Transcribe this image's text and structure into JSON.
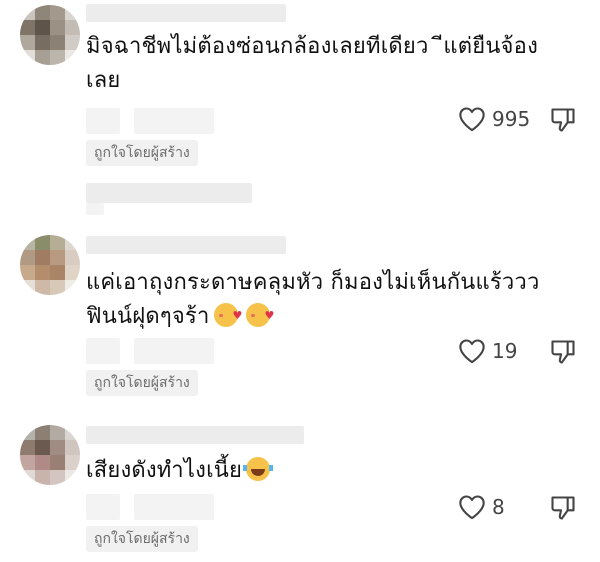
{
  "comments": [
    {
      "text_line1": "มิจฉาชีพไม่ต้องซ่อนกล้องเลยทีเดียว ​ ีแต่ยืนจ้อง",
      "text_line2": "เลย",
      "liked_by_creator_label": "ถูกใจโดยผู้สร้าง",
      "like_count": "995"
    },
    {
      "text_line1": "แค่เอาถุงกระดาษคลุมหัว ก็มองไม่เห็นกันแร้ววว",
      "text_line2": "ฟินน์ฝุดๆจร้า",
      "liked_by_creator_label": "ถูกใจโดยผู้สร้าง",
      "like_count": "19"
    },
    {
      "text_line1": "เสียงดังทำไงเนี้ย",
      "liked_by_creator_label": "ถูกใจโดยผู้สร้าง",
      "like_count": "8"
    }
  ],
  "icons": {
    "like": "heart-outline-icon",
    "dislike": "thumbs-down-outline-icon",
    "emoji_love": "smiling-face-with-hearts-emoji",
    "emoji_laugh": "tears-of-joy-emoji"
  },
  "colors": {
    "text": "#111111",
    "muted": "#6b6b6b",
    "badge_bg": "#f1f1f1",
    "icon": "#444444"
  }
}
